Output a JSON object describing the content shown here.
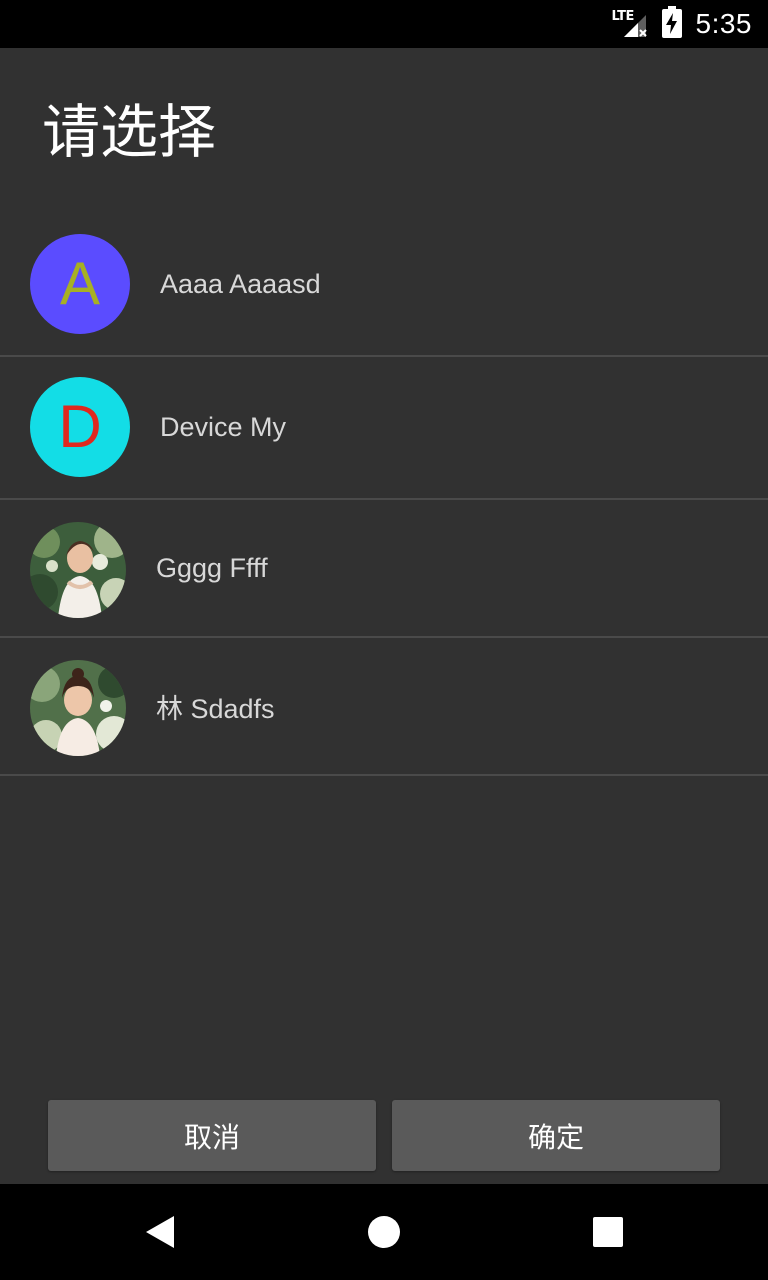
{
  "status_bar": {
    "network": "LTE",
    "time": "5:35",
    "icons": [
      "lte-signal-icon",
      "battery-charging-icon"
    ]
  },
  "dialog": {
    "title": "请选择"
  },
  "contacts": [
    {
      "name": "Aaaa Aaaasd",
      "avatar_type": "letter",
      "letter": "A",
      "avatar_bg": "#5b4cff",
      "letter_color": "#a7b024"
    },
    {
      "name": "Device My",
      "avatar_type": "letter",
      "letter": "D",
      "avatar_bg": "#13dde6",
      "letter_color": "#e0281e"
    },
    {
      "name": "Gggg Ffff",
      "avatar_type": "photo"
    },
    {
      "name": "林 Sdadfs",
      "avatar_type": "photo"
    }
  ],
  "buttons": {
    "cancel": "取消",
    "confirm": "确定"
  },
  "nav_bar": {
    "icons": [
      "back-icon",
      "home-icon",
      "recents-icon"
    ]
  },
  "colors": {
    "background": "#313131",
    "divider": "#4a4a4a",
    "button_bg": "#5a5a5a"
  }
}
